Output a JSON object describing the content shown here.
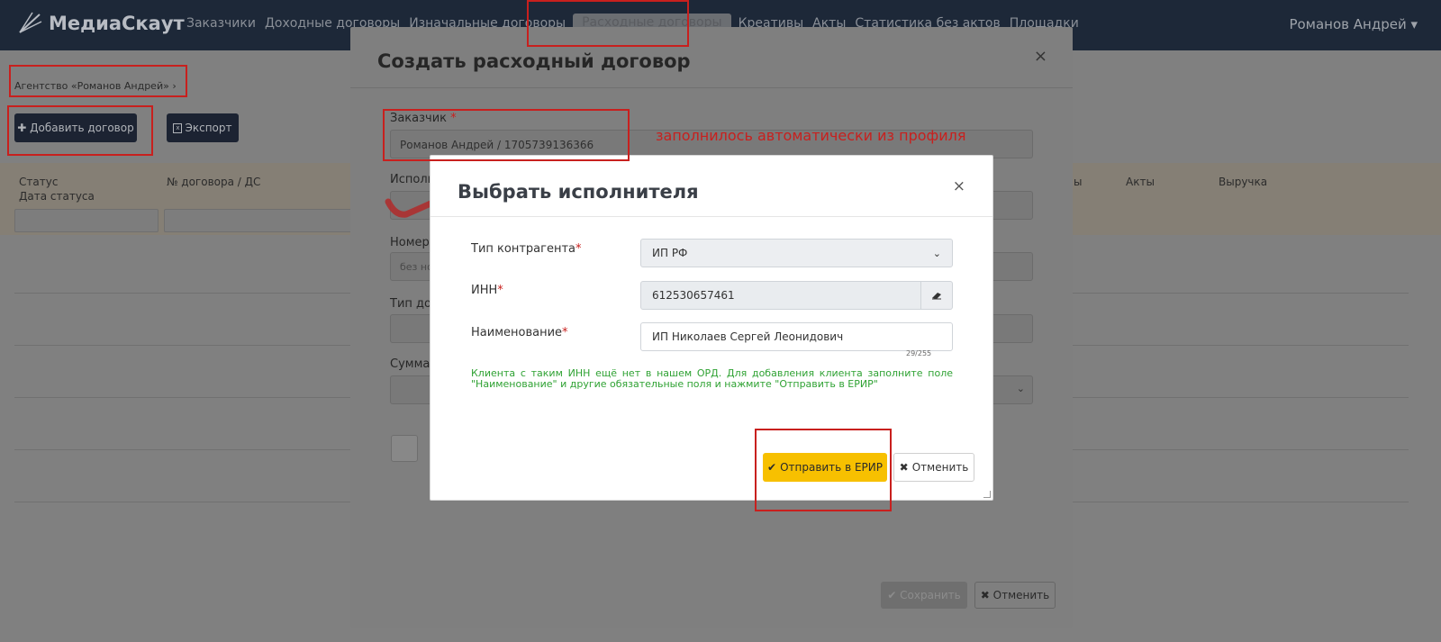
{
  "navbar": {
    "logo_text": "МедиаСкаут",
    "items": [
      "Заказчики",
      "Доходные договоры",
      "Изначальные договоры",
      "Расходные договоры",
      "Креативы",
      "Акты",
      "Статистика без актов",
      "Площадки"
    ],
    "active_item": "Расходные договоры",
    "user": "Романов Андрей ▾"
  },
  "page": {
    "breadcrumb": "Агентство «Романов Андрей»  ›",
    "add_button": "✚ Добавить договор",
    "export_button": "Экспорт",
    "columns": {
      "status": "Статус",
      "status_date": "Дата статуса",
      "contract_no": "№ договора / ДС",
      "col_y": "ы",
      "acts": "Акты",
      "revenue": "Выручка"
    }
  },
  "modal": {
    "title": "Создать расходный договор",
    "close": "×",
    "customer_label": "Заказчик",
    "required_mark": "*",
    "customer_value": "Романов Андрей / 1705739136366",
    "executor_label": "Исполн",
    "number_label": "Номер",
    "number_placeholder": "без но",
    "type_label": "Тип до",
    "sum_label": "Сумма",
    "save_button": "✔ Сохранить",
    "cancel_button": "✖ Отменить"
  },
  "annotations": {
    "auto_note": "заполнилось автоматически из профиля"
  },
  "inner_modal": {
    "title": "Выбрать исполнителя",
    "close": "×",
    "contractor_type_label": "Тип контрагента",
    "contractor_type_value": "ИП РФ",
    "inn_label": "ИНН",
    "inn_value": "612530657461",
    "name_label": "Наименование",
    "name_value": "ИП Николаев Сергей Леонидович",
    "name_counter": "29/255",
    "message": "Клиента с таким ИНН ещё нет в нашем ОРД. Для добавления клиента заполните поле \"Наименование\" и другие обязательные поля и нажмите \"Отправить в ЕРИР\"",
    "send_button": "Отправить в ЕРИР",
    "cancel_button": "Отменить"
  },
  "colors": {
    "navbar": "#1d2838",
    "accent_yellow": "#f7c000",
    "annotation_red": "#c8201e",
    "message_green": "#2fa233"
  }
}
